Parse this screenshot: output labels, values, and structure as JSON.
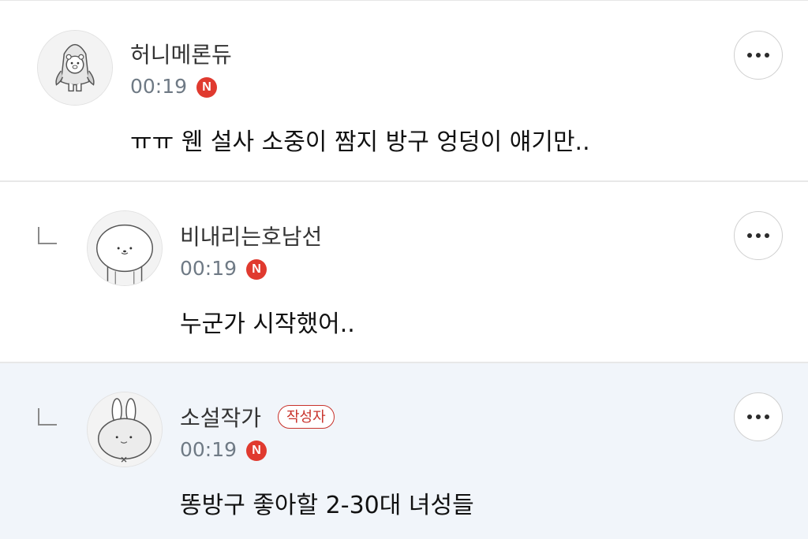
{
  "comments": [
    {
      "nickname": "허니메론듀",
      "time": "00:19",
      "badge": "N",
      "text": "ㅠㅠ 웬 설사 소중이 짬지 방구 엉덩이 얘기만..",
      "is_reply": false,
      "avatar_icon": "penguin-bear-avatar-icon"
    },
    {
      "nickname": "비내리는호남선",
      "time": "00:19",
      "badge": "N",
      "text": "누군가 시작했어..",
      "is_reply": true,
      "avatar_icon": "round-face-avatar-icon"
    },
    {
      "nickname": "소설작가",
      "author_tag": "작성자",
      "time": "00:19",
      "badge": "N",
      "text": "똥방구 좋아할 2-30대 녀성들",
      "is_reply": true,
      "avatar_icon": "bunny-avatar-icon"
    }
  ],
  "colors": {
    "new_badge": "#e03a2f",
    "author_tag": "#c8322b",
    "highlight_bg": "#f1f5fa",
    "time_text": "#6f7a85"
  }
}
